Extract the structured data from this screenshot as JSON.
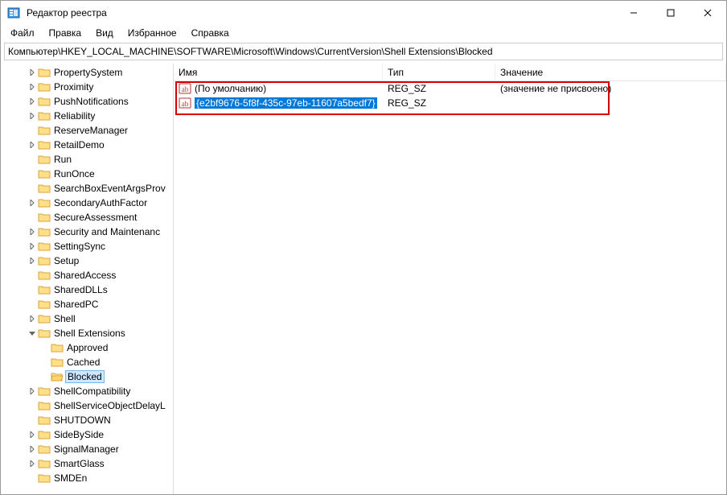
{
  "window": {
    "title": "Редактор реестра"
  },
  "menu": {
    "file": "Файл",
    "edit": "Правка",
    "view": "Вид",
    "favorites": "Избранное",
    "help": "Справка"
  },
  "address": {
    "path": "Компьютер\\HKEY_LOCAL_MACHINE\\SOFTWARE\\Microsoft\\Windows\\CurrentVersion\\Shell Extensions\\Blocked"
  },
  "tree": {
    "items": [
      {
        "label": "PropertySystem",
        "arrow": "closed",
        "depth": 2
      },
      {
        "label": "Proximity",
        "arrow": "closed",
        "depth": 2
      },
      {
        "label": "PushNotifications",
        "arrow": "closed",
        "depth": 2
      },
      {
        "label": "Reliability",
        "arrow": "closed",
        "depth": 2
      },
      {
        "label": "ReserveManager",
        "arrow": "none",
        "depth": 2
      },
      {
        "label": "RetailDemo",
        "arrow": "closed",
        "depth": 2
      },
      {
        "label": "Run",
        "arrow": "none",
        "depth": 2
      },
      {
        "label": "RunOnce",
        "arrow": "none",
        "depth": 2
      },
      {
        "label": "SearchBoxEventArgsProv",
        "arrow": "none",
        "depth": 2
      },
      {
        "label": "SecondaryAuthFactor",
        "arrow": "closed",
        "depth": 2
      },
      {
        "label": "SecureAssessment",
        "arrow": "none",
        "depth": 2
      },
      {
        "label": "Security and Maintenanc",
        "arrow": "closed",
        "depth": 2
      },
      {
        "label": "SettingSync",
        "arrow": "closed",
        "depth": 2
      },
      {
        "label": "Setup",
        "arrow": "closed",
        "depth": 2
      },
      {
        "label": "SharedAccess",
        "arrow": "none",
        "depth": 2
      },
      {
        "label": "SharedDLLs",
        "arrow": "none",
        "depth": 2
      },
      {
        "label": "SharedPC",
        "arrow": "none",
        "depth": 2
      },
      {
        "label": "Shell",
        "arrow": "closed",
        "depth": 2
      },
      {
        "label": "Shell Extensions",
        "arrow": "open",
        "depth": 2
      },
      {
        "label": "Approved",
        "arrow": "none",
        "depth": 3
      },
      {
        "label": "Cached",
        "arrow": "none",
        "depth": 3
      },
      {
        "label": "Blocked",
        "arrow": "none",
        "depth": 3,
        "selected": true,
        "open_folder": true
      },
      {
        "label": "ShellCompatibility",
        "arrow": "closed",
        "depth": 2
      },
      {
        "label": "ShellServiceObjectDelayL",
        "arrow": "none",
        "depth": 2
      },
      {
        "label": "SHUTDOWN",
        "arrow": "none",
        "depth": 2
      },
      {
        "label": "SideBySide",
        "arrow": "closed",
        "depth": 2
      },
      {
        "label": "SignalManager",
        "arrow": "closed",
        "depth": 2
      },
      {
        "label": "SmartGlass",
        "arrow": "closed",
        "depth": 2
      },
      {
        "label": "SMDEn",
        "arrow": "none",
        "depth": 2
      }
    ]
  },
  "list": {
    "columns": {
      "name": "Имя",
      "type": "Тип",
      "value": "Значение"
    },
    "rows": [
      {
        "name": "(По умолчанию)",
        "type": "REG_SZ",
        "value": "(значение не присвоено)",
        "icon": "string",
        "selected": false
      },
      {
        "name": "{e2bf9676-5f8f-435c-97eb-11607a5bedf7}",
        "type": "REG_SZ",
        "value": "",
        "icon": "string",
        "selected": true
      }
    ]
  }
}
